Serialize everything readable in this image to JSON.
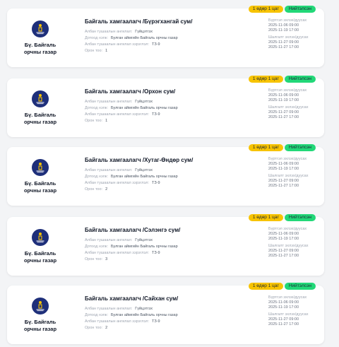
{
  "colors": {
    "badge_time": "#f7c300",
    "badge_status": "#22d878",
    "logo_bg": "#1e2f7a"
  },
  "labels": {
    "staff_type": "Албан тушаалын ангилал:",
    "unit": "Дотоод нэгж:",
    "rank": "Албан тушаалын ангилал зэрэглэл:",
    "count": "Орон тоо:",
    "reg_start": "Бүртгэл эхлэх/дуусах",
    "exam_time": "Шалгалт эхлэх/дуусах"
  },
  "cards": [
    {
      "badge_time": "1 өдөр 1 цаг",
      "badge_status": "Нийтэлсэн",
      "org": "Бү. Байгаль орчны газар",
      "title": "Байгаль хамгаалагч /Бүрэгхангай сум/",
      "staff_type": "Гүйцэтгэх",
      "unit": "Булган аймгийн Байгаль орчны газар",
      "rank": "ТЗ-9",
      "count": "1",
      "reg_from": "2025-11-06 09:00",
      "reg_to": "2025-11-19 17:00",
      "exam_from": "2025-11-27 09:00",
      "exam_to": "2025-11-27 17:00"
    },
    {
      "badge_time": "1 өдөр 1 цаг",
      "badge_status": "Нийтэлсэн",
      "org": "Бү. Байгаль орчны газар",
      "title": "Байгаль хамгаалагч /Орхон сум/",
      "staff_type": "Гүйцэтгэх",
      "unit": "Булган аймгийн Байгаль орчны газар",
      "rank": "ТЗ-9",
      "count": "1",
      "reg_from": "2025-11-06 09:00",
      "reg_to": "2025-11-19 17:00",
      "exam_from": "2025-11-27 09:00",
      "exam_to": "2025-11-27 17:00"
    },
    {
      "badge_time": "1 өдөр 1 цаг",
      "badge_status": "Нийтэлсэн",
      "org": "Бү. Байгаль орчны газар",
      "title": "Байгаль хамгаалагч /Хутаг-Өндөр сум/",
      "staff_type": "Гүйцэтгэх",
      "unit": "Булган аймгийн Байгаль орчны газар",
      "rank": "ТЗ-9",
      "count": "2",
      "reg_from": "2025-11-06 09:00",
      "reg_to": "2025-11-19 17:00",
      "exam_from": "2025-11-27 09:00",
      "exam_to": "2025-11-27 17:00"
    },
    {
      "badge_time": "1 өдөр 1 цаг",
      "badge_status": "Нийтэлсэн",
      "org": "Бү. Байгаль орчны газар",
      "title": "Байгаль хамгаалагч /Сэлэнгэ сум/",
      "staff_type": "Гүйцэтгэх",
      "unit": "Булган аймгийн Байгаль орчны газар",
      "rank": "ТЗ-9",
      "count": "3",
      "reg_from": "2025-11-06 09:00",
      "reg_to": "2025-11-19 17:00",
      "exam_from": "2025-11-27 09:00",
      "exam_to": "2025-11-27 17:00"
    },
    {
      "badge_time": "1 өдөр 1 цаг",
      "badge_status": "Нийтэлсэн",
      "org": "Бү. Байгаль орчны газар",
      "title": "Байгаль хамгаалагч /Сайхан сум/",
      "staff_type": "Гүйцэтгэх",
      "unit": "Булган аймгийн Байгаль орчны газар",
      "rank": "ТЗ-9",
      "count": "2",
      "reg_from": "2025-11-06 09:00",
      "reg_to": "2025-11-19 17:00",
      "exam_from": "2025-11-27 09:00",
      "exam_to": "2025-11-27 17:00"
    }
  ]
}
